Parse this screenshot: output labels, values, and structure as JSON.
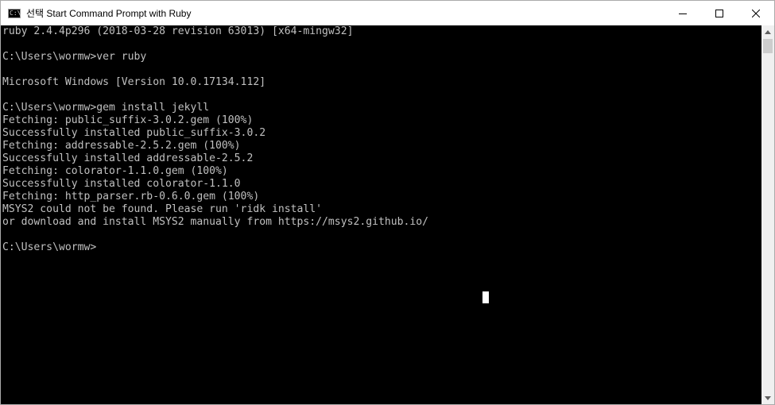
{
  "window": {
    "title": "선택 Start Command Prompt with Ruby",
    "app_icon_text": "C:\\"
  },
  "controls": {
    "minimize": "minimize",
    "maximize": "maximize",
    "close": "close"
  },
  "console": {
    "lines": [
      "ruby 2.4.4p296 (2018-03-28 revision 63013) [x64-mingw32]",
      "",
      "C:\\Users\\wormw>ver ruby",
      "",
      "Microsoft Windows [Version 10.0.17134.112]",
      "",
      "C:\\Users\\wormw>gem install jekyll",
      "Fetching: public_suffix-3.0.2.gem (100%)",
      "Successfully installed public_suffix-3.0.2",
      "Fetching: addressable-2.5.2.gem (100%)",
      "Successfully installed addressable-2.5.2",
      "Fetching: colorator-1.1.0.gem (100%)",
      "Successfully installed colorator-1.1.0",
      "Fetching: http_parser.rb-0.6.0.gem (100%)",
      "MSYS2 could not be found. Please run 'ridk install'",
      "or download and install MSYS2 manually from https://msys2.github.io/",
      "",
      "C:\\Users\\wormw>"
    ],
    "text_color": "#c0c0c0",
    "background": "#000000"
  }
}
